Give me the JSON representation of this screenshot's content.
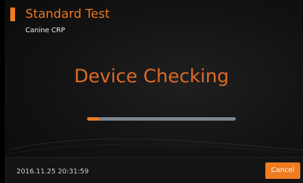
{
  "header": {
    "title": "Standard Test",
    "subtitle": "Canine CRP"
  },
  "main": {
    "status": "Device Checking",
    "progress": 0.08
  },
  "footer": {
    "timestamp": "2016.11.25 20:31:59",
    "cancel_label": "Cancel"
  },
  "colors": {
    "accent": "#ef7d20",
    "heading": "#df6b25",
    "track": "#7d8690",
    "background": "#121212"
  }
}
